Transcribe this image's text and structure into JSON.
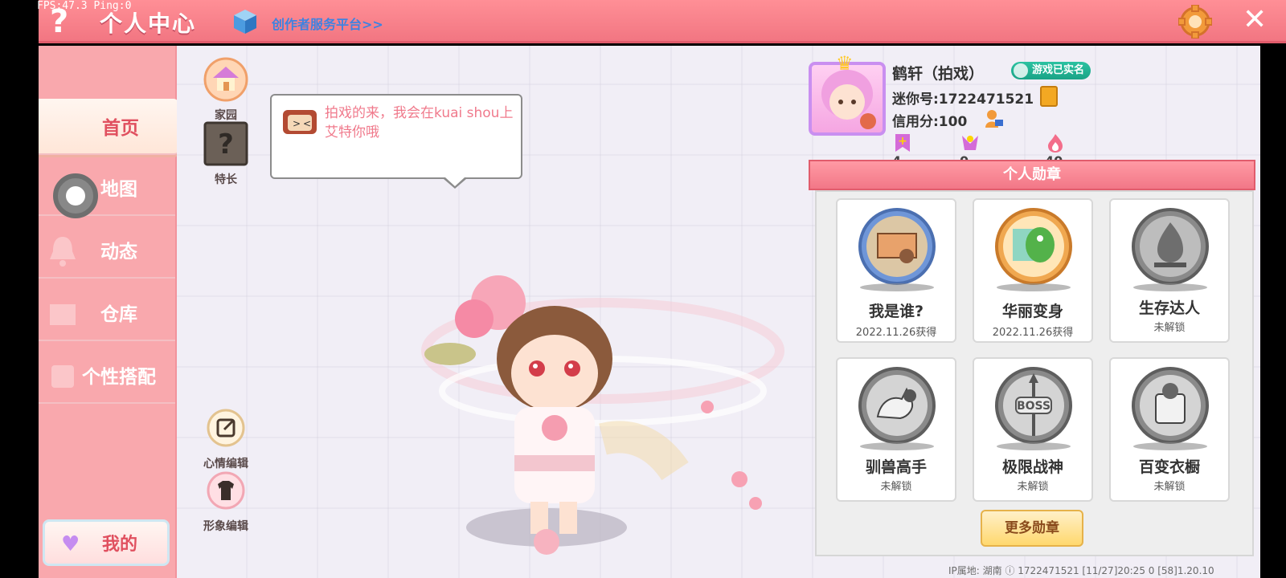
{
  "overlay": {
    "fps": "FPS:47.3  Ping:0"
  },
  "header": {
    "help_glyph": "?",
    "title": "个人中心",
    "creator_link": "创作者服务平台>>",
    "close_glyph": "✕"
  },
  "sidebar": {
    "items": [
      {
        "label": "首页",
        "active": true
      },
      {
        "label": "地图",
        "active": false
      },
      {
        "label": "动态",
        "active": false
      },
      {
        "label": "仓库",
        "active": false
      },
      {
        "label": "个性搭配",
        "active": false
      }
    ],
    "mine_label": "我的"
  },
  "home": {
    "garden_label": "家园",
    "talent_label": "特长",
    "mood_edit_label": "心情编辑",
    "image_edit_label": "形象编辑",
    "speech": "拍戏的来，我会在kuai shou上艾特你哦"
  },
  "profile": {
    "name": "鹤轩（拍戏）",
    "verified_badge": "游戏已实名",
    "mini_id": "迷你号:1722471521",
    "credit": "信用分:100",
    "stats": [
      "4",
      "0",
      "40"
    ]
  },
  "medals": {
    "header": "个人勋章",
    "items": [
      {
        "name": "我是谁?",
        "sub": "2022.11.26获得",
        "icon": "mail-hand-medal-icon",
        "color": "#8fb3e8"
      },
      {
        "name": "华丽变身",
        "sub": "2022.11.26获得",
        "icon": "dino-medal-icon",
        "color": "#f0a850"
      },
      {
        "name": "生存达人",
        "sub": "未解锁",
        "icon": "campfire-medal-icon",
        "color": "#9a9a9a"
      },
      {
        "name": "驯兽高手",
        "sub": "未解锁",
        "icon": "beast-medal-icon",
        "color": "#9a9a9a"
      },
      {
        "name": "极限战神",
        "sub": "未解锁",
        "icon": "boss-medal-icon",
        "color": "#9a9a9a"
      },
      {
        "name": "百变衣橱",
        "sub": "未解锁",
        "icon": "wardrobe-medal-icon",
        "color": "#9a9a9a"
      }
    ],
    "more_label": "更多勋章"
  },
  "footer": {
    "text": "IP属地: 湖南 ⓘ      1722471521    [11/27]20:25 0  [58]1.20.10"
  }
}
